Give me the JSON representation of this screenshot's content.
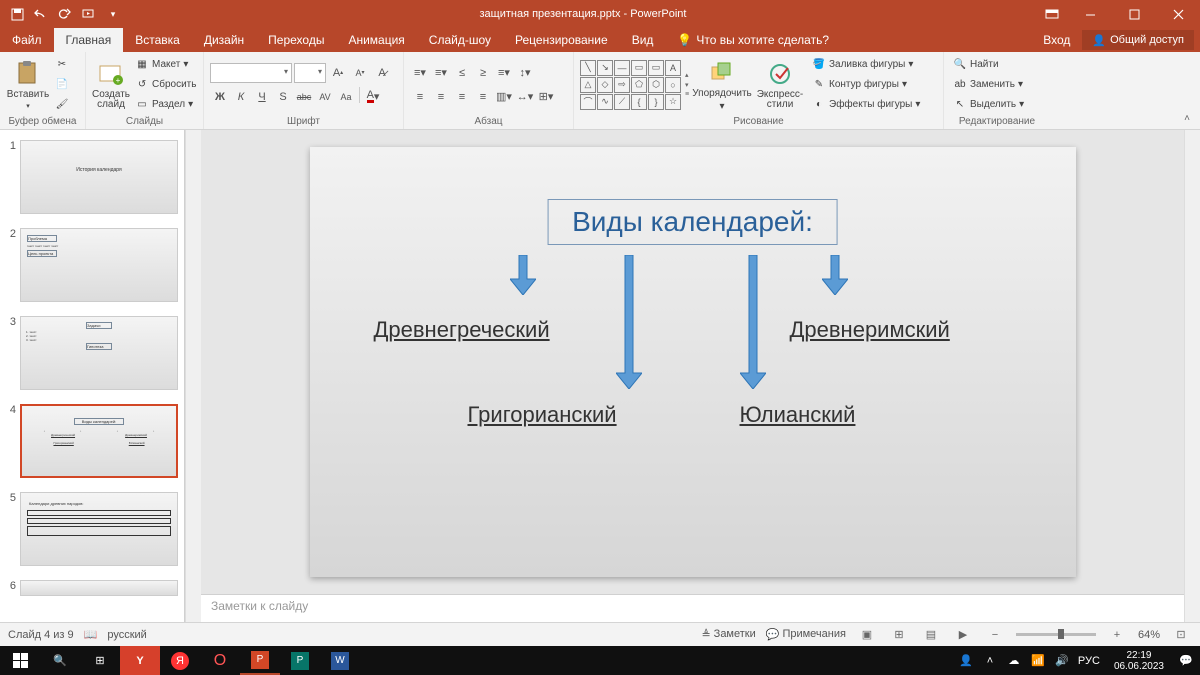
{
  "title": "защитная презентация.pptx - PowerPoint",
  "tabs": {
    "file": "Файл",
    "home": "Главная",
    "insert": "Вставка",
    "design": "Дизайн",
    "transitions": "Переходы",
    "animations": "Анимация",
    "slideshow": "Слайд-шоу",
    "review": "Рецензирование",
    "view": "Вид",
    "tell": "Что вы хотите сделать?",
    "login": "Вход",
    "share": "Общий доступ"
  },
  "ribbon": {
    "clipboard": {
      "paste": "Вставить",
      "label": "Буфер обмена"
    },
    "slides": {
      "new": "Создать\nслайд",
      "layout": "Макет",
      "reset": "Сбросить",
      "section": "Раздел",
      "label": "Слайды"
    },
    "font": {
      "label": "Шрифт",
      "bold": "Ж",
      "italic": "К",
      "underline": "Ч",
      "strike": "S",
      "abc": "abc",
      "av": "AV",
      "aa": "Aa",
      "clear": "A"
    },
    "paragraph": {
      "label": "Абзац"
    },
    "drawing": {
      "arrange": "Упорядочить",
      "styles": "Экспресс-\nстили",
      "fill": "Заливка фигуры",
      "outline": "Контур фигуры",
      "effects": "Эффекты фигуры",
      "label": "Рисование"
    },
    "editing": {
      "find": "Найти",
      "replace": "Заменить",
      "select": "Выделить",
      "label": "Редактирование"
    }
  },
  "slide": {
    "title": "Виды календарей:",
    "items": [
      "Древнегреческий",
      "Древнеримский",
      "Григорианский",
      "Юлианский"
    ]
  },
  "notes": "Заметки к слайду",
  "status": {
    "slide": "Слайд 4 из 9",
    "lang": "русский",
    "notes": "Заметки",
    "comments": "Примечания",
    "zoom": "64%"
  },
  "taskbar": {
    "lang": "РУС",
    "time": "22:19",
    "date": "06.06.2023"
  },
  "thumbs": [
    "1",
    "2",
    "3",
    "4",
    "5",
    "6"
  ]
}
